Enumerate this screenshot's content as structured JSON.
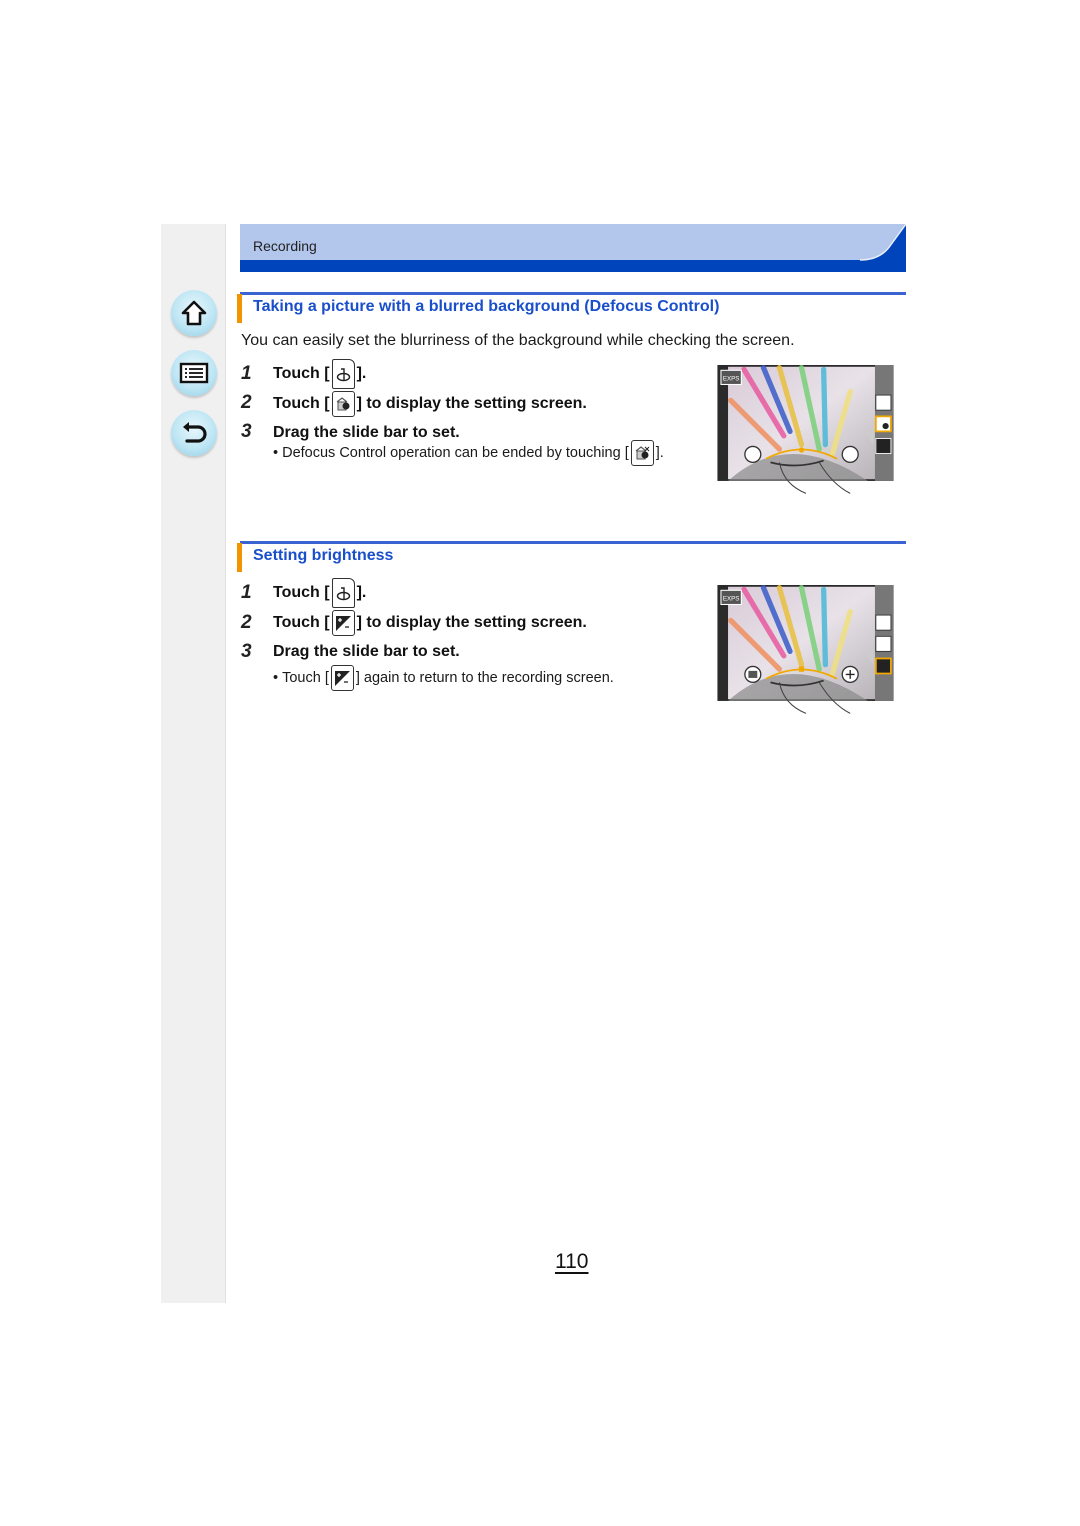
{
  "header": {
    "section_label": "Recording"
  },
  "sidebar": {
    "buttons": [
      {
        "name": "home",
        "icon": "home-icon"
      },
      {
        "name": "contents",
        "icon": "list-icon"
      },
      {
        "name": "back",
        "icon": "return-arrow-icon"
      }
    ]
  },
  "sections": [
    {
      "title": "Taking a picture with a blurred background (Defocus Control)",
      "intro": "You can easily set the blurriness of the background while checking the screen.",
      "steps": [
        {
          "num": "1",
          "pre": "Touch [",
          "icon": "defocus-mode-icon",
          "post": "]."
        },
        {
          "num": "2",
          "pre": "Touch [",
          "icon": "defocus-setting-icon",
          "post": "] to display the setting screen."
        },
        {
          "num": "3",
          "text": "Drag the slide bar to set."
        }
      ],
      "note": {
        "bullet": "•",
        "pre": "Defocus Control operation can be ended by touching [",
        "icon": "defocus-setting-icon",
        "post": "]."
      },
      "screen": {
        "badge": "EXPS",
        "active_tool": "defocus"
      }
    },
    {
      "title": "Setting brightness",
      "steps": [
        {
          "num": "1",
          "pre": "Touch [",
          "icon": "defocus-mode-icon",
          "post": "]."
        },
        {
          "num": "2",
          "pre": "Touch [",
          "icon": "exposure-compensation-icon",
          "post": "] to display the setting screen."
        },
        {
          "num": "3",
          "text": "Drag the slide bar to set."
        }
      ],
      "note": {
        "bullet": "•",
        "pre": "Touch [",
        "icon": "exposure-compensation-icon",
        "post": "] again to return to the recording screen."
      },
      "screen": {
        "badge": "EXPS",
        "active_tool": "brightness"
      }
    }
  ],
  "footer": {
    "page_number": "110"
  },
  "colors": {
    "accent_blue": "#1a4fcb",
    "header_dark": "#0044bb",
    "header_light": "#b3c6ec",
    "section_marker": "#f29400"
  }
}
